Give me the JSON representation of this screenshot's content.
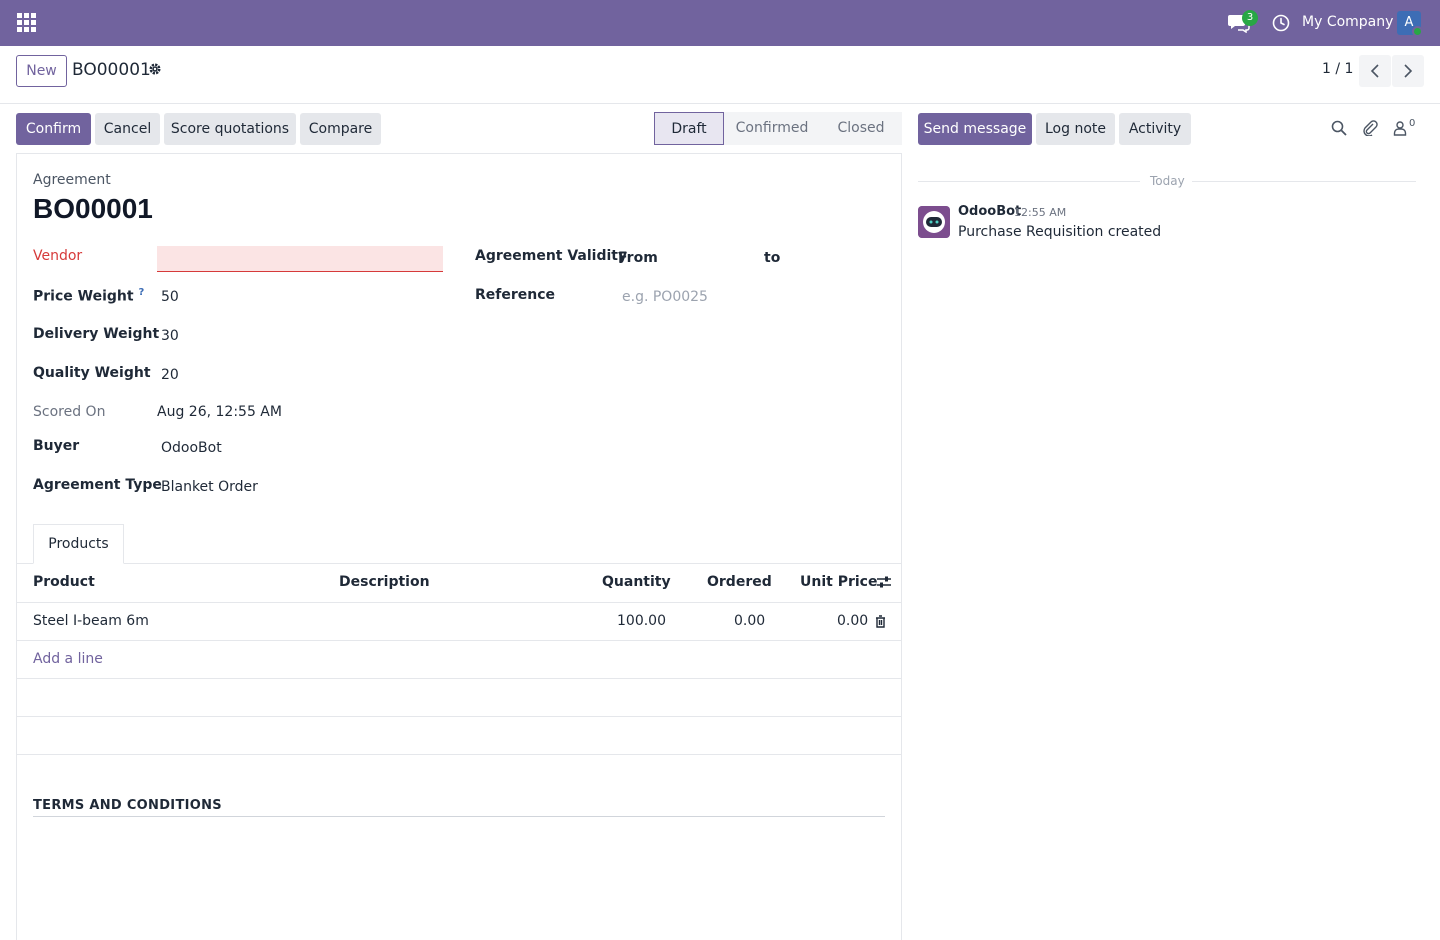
{
  "navbar": {
    "company": "My Company",
    "chat_count": "3",
    "avatar_letter": "A",
    "brand_color": "#71639e"
  },
  "control": {
    "new_label": "New",
    "record_name": "BO00001",
    "pager": "1 / 1"
  },
  "actions": {
    "confirm": "Confirm",
    "cancel": "Cancel",
    "score": "Score quotations",
    "compare": "Compare"
  },
  "statusbar": {
    "stages": [
      "Draft",
      "Confirmed",
      "Closed"
    ],
    "active": "Draft"
  },
  "form": {
    "subtitle": "Agreement",
    "title": "BO00001",
    "vendor_label": "Vendor",
    "vendor_value": "",
    "price_weight_label": "Price Weight",
    "price_weight_help": "?",
    "price_weight": "50",
    "delivery_weight_label": "Delivery Weight",
    "delivery_weight": "30",
    "quality_weight_label": "Quality Weight",
    "quality_weight": "20",
    "scored_on_label": "Scored On",
    "scored_on": "Aug 26, 12:55 AM",
    "buyer_label": "Buyer",
    "buyer": "OdooBot",
    "agreement_type_label": "Agreement Type",
    "agreement_type": "Blanket Order",
    "validity_label": "Agreement Validity",
    "validity_from": "From",
    "validity_to": "to",
    "reference_label": "Reference",
    "reference_placeholder": "e.g. PO0025"
  },
  "tabs": {
    "products": "Products"
  },
  "table": {
    "headers": {
      "product": "Product",
      "description": "Description",
      "quantity": "Quantity",
      "ordered": "Ordered",
      "unit_price": "Unit Price"
    },
    "rows": [
      {
        "product": "Steel I-beam 6m",
        "description": "",
        "quantity": "100.00",
        "ordered": "0.00",
        "unit_price": "0.00"
      }
    ],
    "add_line": "Add a line"
  },
  "terms": {
    "title": "TERMS AND CONDITIONS"
  },
  "chatter": {
    "send_message": "Send message",
    "log_note": "Log note",
    "activity": "Activity",
    "followers_count": "0",
    "date_separator": "Today",
    "messages": [
      {
        "author": "OdooBot",
        "time": "12:55 AM",
        "body": "Purchase Requisition created"
      }
    ]
  }
}
